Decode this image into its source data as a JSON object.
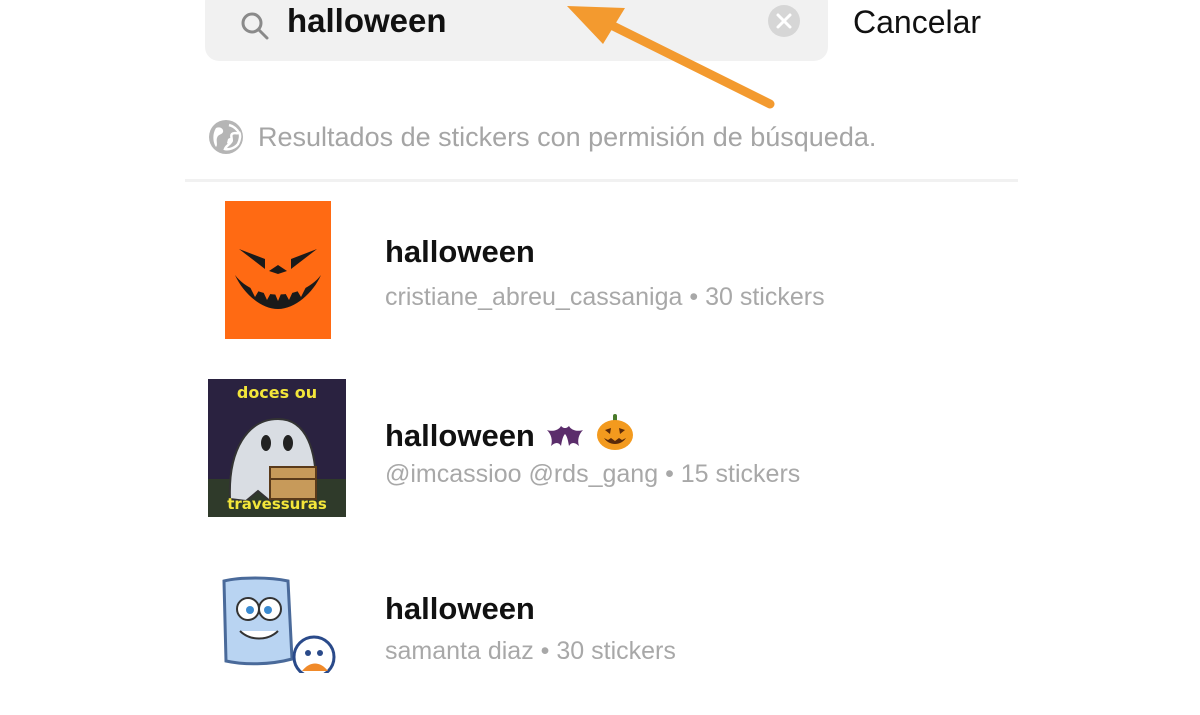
{
  "search": {
    "value": "halloween",
    "cancel_label": "Cancelar"
  },
  "hint": {
    "text": "Resultados de stickers con permisión de búsqueda."
  },
  "results": [
    {
      "title": "halloween",
      "author": "cristiane_abreu_cassaniga",
      "separator": "•",
      "count": "30 stickers"
    },
    {
      "title": "halloween",
      "author": "@imcassioo @rds_gang",
      "separator": "•",
      "count": "15 stickers",
      "thumb_top_text": "doces ou",
      "thumb_bottom_text": "travessuras"
    },
    {
      "title": "halloween",
      "author": "samanta diaz",
      "separator": "•",
      "count": "30 stickers"
    }
  ],
  "colors": {
    "arrow": "#f39a2f",
    "pumpkin_bg": "#ff6a13",
    "muted_text": "#a8a8a8"
  }
}
